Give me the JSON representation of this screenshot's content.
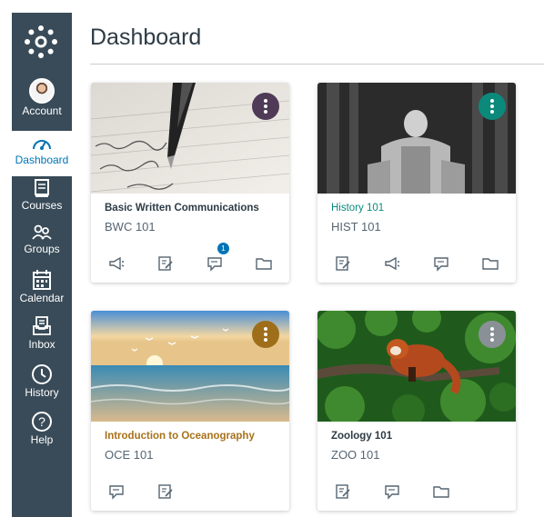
{
  "header": {
    "title": "Dashboard"
  },
  "nav": [
    {
      "id": "account",
      "label": "Account"
    },
    {
      "id": "dashboard",
      "label": "Dashboard"
    },
    {
      "id": "courses",
      "label": "Courses"
    },
    {
      "id": "groups",
      "label": "Groups"
    },
    {
      "id": "calendar",
      "label": "Calendar"
    },
    {
      "id": "inbox",
      "label": "Inbox"
    },
    {
      "id": "history",
      "label": "History"
    },
    {
      "id": "help",
      "label": "Help"
    }
  ],
  "cards": [
    {
      "title": "Basic Written Communications",
      "code": "BWC 101",
      "title_color": "#2D3B45",
      "menu_color": "#4F3A57",
      "icons": [
        "announcements-icon",
        "assignments-icon",
        "discussions-icon",
        "files-icon"
      ],
      "badge": "1"
    },
    {
      "title": "History 101",
      "code": "HIST 101",
      "title_color": "#0B8A7C",
      "menu_color": "#0B8A7C",
      "icons": [
        "assignments-icon",
        "announcements-icon",
        "discussions-icon",
        "files-icon"
      ]
    },
    {
      "title": "Introduction to Oceanography",
      "code": "OCE 101",
      "title_color": "#A77219",
      "menu_color": "#9E6E1A",
      "icons": [
        "discussions-icon",
        "assignments-icon"
      ]
    },
    {
      "title": "Zoology 101",
      "code": "ZOO 101",
      "title_color": "#2D3B45",
      "menu_color": "#8A9196",
      "icons": [
        "assignments-icon",
        "discussions-icon",
        "files-icon"
      ]
    }
  ],
  "colors": {
    "sidebar": "#394B58",
    "active_nav": "#0374B5"
  }
}
